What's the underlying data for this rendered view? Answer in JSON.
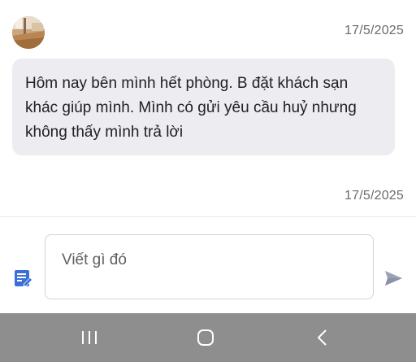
{
  "chat": {
    "messages": [
      {
        "timestamp": "17/5/2025",
        "text": "Hôm nay bên mình hết phòng. B đặt khách sạn khác giúp mình. Mình có gửi yêu cầu huỷ nhưng không thấy mình trả lời"
      }
    ],
    "second_timestamp": "17/5/2025"
  },
  "composer": {
    "placeholder": "Viết gì đó"
  },
  "icons": {
    "compose": "edit-note-icon",
    "send": "send-icon",
    "recent": "recent-apps-icon",
    "home": "home-icon",
    "back": "back-icon"
  },
  "colors": {
    "bubble_bg": "#ececf1",
    "accent_blue": "#3a6fd8",
    "send_gray": "#9aa3b5",
    "navbar_bg": "#8e8e8e"
  }
}
